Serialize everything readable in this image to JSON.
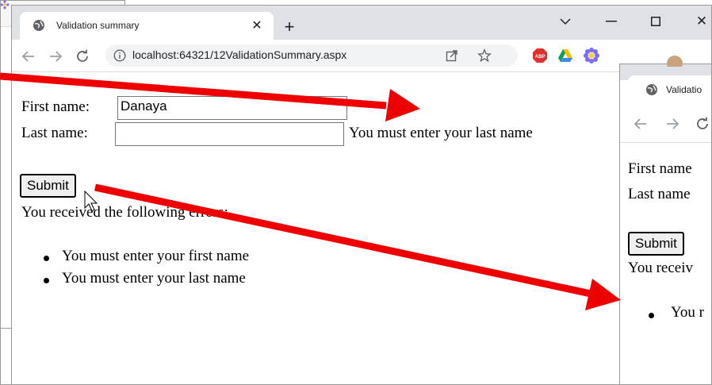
{
  "main": {
    "tab_title": "Validation summary",
    "url": "localhost:64321/12ValidationSummary.aspx",
    "first_name_label": "First name:",
    "first_name_value": "Danaya",
    "last_name_label": "Last name:",
    "last_name_value": "",
    "last_name_error": "You must enter your last name",
    "submit_label": "Submit",
    "summary_heading": "You received the following errors:",
    "errors": [
      "You must enter your first name",
      "You must enter your last name"
    ]
  },
  "right": {
    "tab_title": "Validatio",
    "first_name_label": "First name",
    "last_name_label": "Last name",
    "submit_label": "Submit",
    "summary_heading": "You receiv",
    "error_partial": "You r"
  },
  "icons": {
    "tab_favicon": "globe-icon",
    "new_tab": "plus-icon",
    "back": "back-arrow-icon",
    "forward": "forward-arrow-icon",
    "reload": "reload-icon",
    "site_info": "info-icon",
    "share": "share-icon",
    "bookmark": "star-icon",
    "extension_abp": "abp-icon",
    "extension_drive": "drive-icon",
    "extension_flower": "flower-icon"
  },
  "annotation": {
    "arrow_color": "#ee0000"
  }
}
